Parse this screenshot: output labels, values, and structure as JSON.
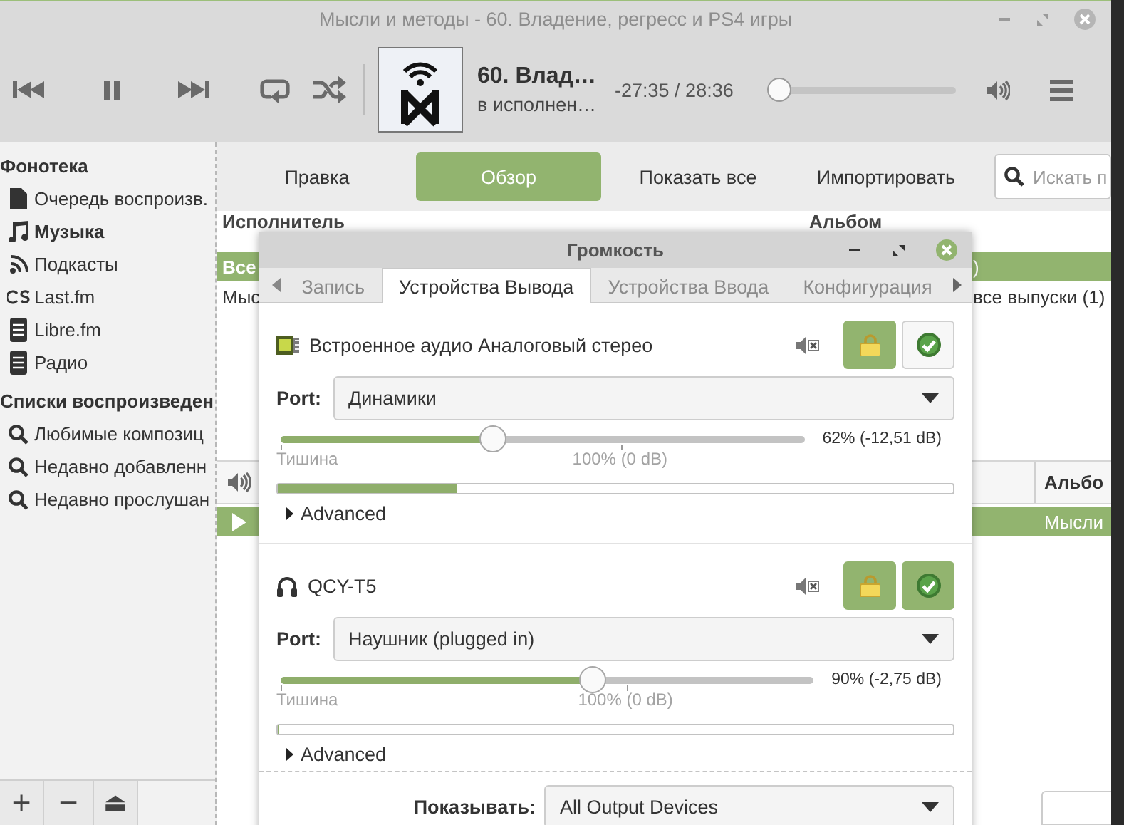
{
  "window": {
    "title": "Мысли и методы - 60. Владение, регресс и PS4 игры"
  },
  "player": {
    "track_title": "60. Влад…",
    "artist": "в исполнен…",
    "time": "-27:35 / 28:36",
    "seek": {
      "level": 0
    }
  },
  "sidebar": {
    "sections": [
      {
        "title": "Фонотека",
        "items": [
          {
            "label": "Очередь воспроизв.",
            "kind": "document",
            "selected": false
          },
          {
            "label": "Музыка",
            "kind": "music",
            "selected": true
          },
          {
            "label": "Подкасты",
            "kind": "feed",
            "selected": false
          },
          {
            "label": "Last.fm",
            "kind": "rings",
            "selected": false
          },
          {
            "label": "Libre.fm",
            "kind": "device",
            "selected": false
          },
          {
            "label": "Радио",
            "kind": "device",
            "selected": false
          }
        ]
      },
      {
        "title": "Списки воспроизведен",
        "items": [
          {
            "label": "Любимые композиц",
            "kind": "search",
            "selected": false
          },
          {
            "label": "Недавно добавленн",
            "kind": "search",
            "selected": false
          },
          {
            "label": "Недавно прослушан",
            "kind": "search",
            "selected": false
          }
        ]
      }
    ],
    "buttons": [
      "+",
      "−",
      "⏏"
    ]
  },
  "library_toolbar": {
    "buttons": [
      {
        "label": "Правка",
        "selected": false
      },
      {
        "label": "Обзор",
        "selected": true
      },
      {
        "label": "Показать все",
        "selected": false
      },
      {
        "label": "Импортировать",
        "selected": false
      }
    ],
    "search": {
      "placeholder": "Искать п"
    }
  },
  "browser": {
    "columns": [
      "Исполнитель",
      "Альбом"
    ],
    "rows": [
      {
        "cells": [
          "Все",
          ")"
        ],
        "selected": true
      },
      {
        "cells": [
          "Мыс",
          "все выпуски (1)"
        ],
        "selected": false
      }
    ]
  },
  "tracklist": {
    "columns": [
      "Альбо"
    ],
    "rows": [
      {
        "album": "Мысли",
        "playing": true,
        "selected": true
      }
    ]
  },
  "volume_dialog": {
    "title": "Громкость",
    "tabs": [
      {
        "label": "Запись",
        "selected": false
      },
      {
        "label": "Устройства Вывода",
        "selected": true
      },
      {
        "label": "Устройства Ввода",
        "selected": false
      },
      {
        "label": "Конфигурация",
        "selected": false
      }
    ],
    "devices": [
      {
        "kind": "sound-card",
        "name": "Встроенное аудио Аналоговый стерео",
        "locked": true,
        "default": false,
        "port_label": "Port:",
        "port": "Динамики",
        "level": 0.405,
        "reading": "62% (-12,51 dB)",
        "min_label": "Тишина",
        "mark_label": "100% (0 dB)",
        "meter": {
          "level": 0.265
        },
        "advanced": "Advanced",
        "expanded": false
      },
      {
        "kind": "headphones",
        "name": "QCY-T5",
        "locked": true,
        "default": true,
        "port_label": "Port:",
        "port": "Наушник (plugged in)",
        "level": 0.585,
        "reading": "90% (-2,75 dB)",
        "min_label": "Тишина",
        "mark_label": "100% (0 dB)",
        "meter": {
          "level": 0
        },
        "advanced": "Advanced",
        "expanded": false
      }
    ],
    "show_label": "Показывать:",
    "show_value": "All Output Devices"
  }
}
